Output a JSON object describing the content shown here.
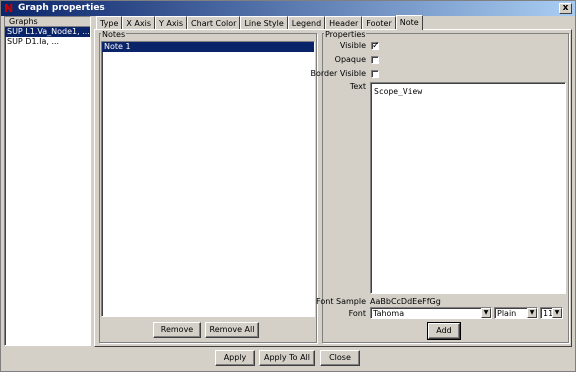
{
  "window": {
    "title": "Graph properties",
    "close_glyph": "x",
    "app_icon": "N"
  },
  "graphs": {
    "header": "Graphs",
    "items": [
      "SUP L1.Va_Node1, ...",
      "SUP D1.Ia, ..."
    ]
  },
  "tabs": [
    "Type",
    "X Axis",
    "Y Axis",
    "Chart Color",
    "Line Style",
    "Legend",
    "Header",
    "Footer",
    "Note"
  ],
  "notes": {
    "group_label": "Notes",
    "items": [
      "Note 1"
    ],
    "remove_label": "Remove",
    "remove_all_label": "Remove All"
  },
  "properties": {
    "group_label": "Properties",
    "visible_label": "Visible",
    "visible_checked": true,
    "opaque_label": "Opaque",
    "opaque_checked": false,
    "border_visible_label": "Border Visible",
    "border_visible_checked": false,
    "text_label": "Text",
    "text_value": "Scope_View",
    "font_sample_label": "Font Sample",
    "font_sample_value": "AaBbCcDdEeFfGg",
    "font_label": "Font",
    "font_value": "Tahoma",
    "style_value": "Plain",
    "size_value": "11",
    "add_label": "Add"
  },
  "footer": {
    "apply_label": "Apply",
    "apply_all_label": "Apply To All",
    "close_label": "Close"
  }
}
